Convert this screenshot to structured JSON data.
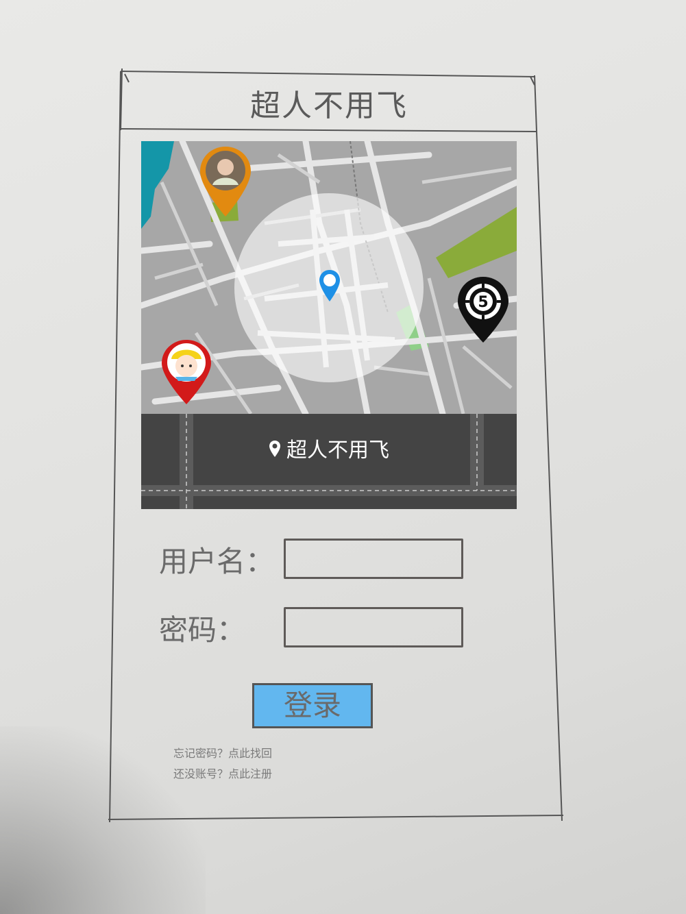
{
  "app": {
    "title": "超人不用飞"
  },
  "map": {
    "location_label": "超人不用飞",
    "marker_number": "5"
  },
  "form": {
    "username_label": "用户名：",
    "username_value": "",
    "password_label": "密码：",
    "password_value": "",
    "login_label": "登录"
  },
  "links": {
    "forgot": "忘记密码？点此找回",
    "register": "还没账号？点此注册"
  },
  "colors": {
    "login_button": "#62b7ef",
    "map_background": "#a7a7a7",
    "location_bar": "#444444",
    "pin_blue": "#1e90e6",
    "pin_orange": "#e28a10",
    "pin_red": "#d21a1a",
    "pin_black": "#111111",
    "park_green": "#8aab3a"
  }
}
